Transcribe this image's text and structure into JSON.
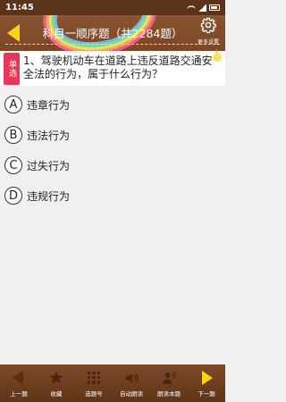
{
  "status": {
    "time": "11:45"
  },
  "header": {
    "title": "科目一顺序题（共2284题）",
    "settings_label": "更多设置"
  },
  "question": {
    "type": "单选",
    "text": "1、驾驶机动车在道路上违反道路交通安全法的行为，属于什么行为？"
  },
  "options": [
    {
      "letter": "A",
      "text": "违章行为"
    },
    {
      "letter": "B",
      "text": "违法行为"
    },
    {
      "letter": "C",
      "text": "过失行为"
    },
    {
      "letter": "D",
      "text": "违规行为"
    }
  ],
  "bottom_nav": {
    "prev": "上一题",
    "favorite": "收藏",
    "select": "选题号",
    "auto_read": "自动朗读",
    "read": "朗读本题",
    "next": "下一题"
  },
  "colors": {
    "header_brown": "#7a4626",
    "type_tag": "#e8385a",
    "accent_yellow": "#ffd21a"
  }
}
